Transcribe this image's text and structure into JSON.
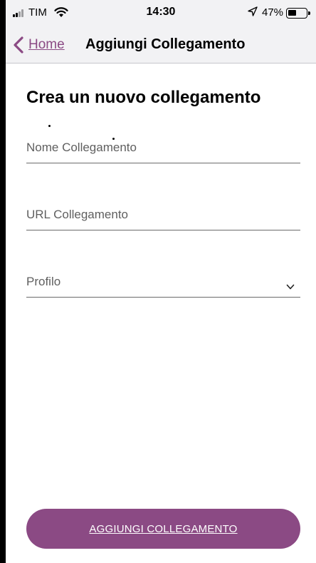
{
  "status_bar": {
    "carrier": "TIM",
    "time": "14:30",
    "battery_percent": "47%",
    "battery_level": 0.47
  },
  "nav": {
    "back_label": "Home",
    "title": "Aggiungi Collegamento"
  },
  "form": {
    "heading": "Crea un nuovo collegamento",
    "fields": [
      {
        "placeholder": "Nome Collegamento",
        "value": ""
      },
      {
        "placeholder": "URL Collegamento",
        "value": ""
      },
      {
        "placeholder": "Profilo",
        "value": "",
        "type": "select"
      }
    ],
    "submit_label": "AGGIUNGI COLLEGAMENTO"
  },
  "icons": {
    "back": "chevron-left-icon",
    "dropdown": "chevron-down-icon",
    "signal": "signal-icon",
    "wifi": "wifi-icon",
    "location": "location-arrow-icon",
    "battery": "battery-icon"
  },
  "colors": {
    "accent": "#8b4a84",
    "bar_background": "#f2f2f4",
    "button_text": "#ffffff",
    "placeholder": "#5f5f5f"
  }
}
